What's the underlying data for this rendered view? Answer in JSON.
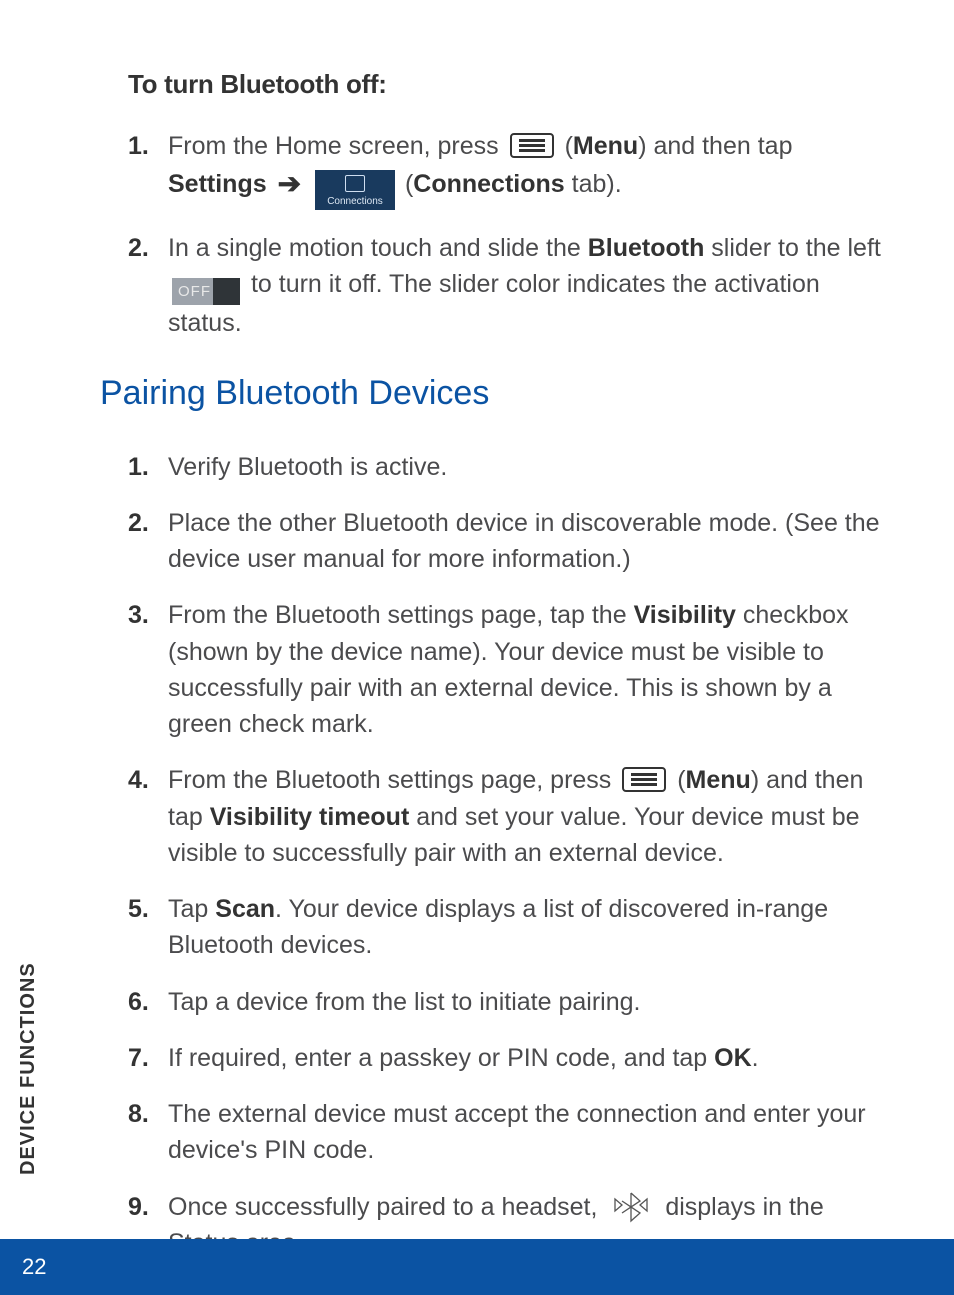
{
  "side_tab": "DEVICE FUNCTIONS",
  "page_number": "22",
  "section1": {
    "heading": "To turn Bluetooth off:",
    "steps": [
      {
        "num": "1.",
        "pre": "From the Home screen, press ",
        "menu_lbl": "Menu",
        "mid": ") and then tap ",
        "settings": "Settings",
        "conn_word": "Connections",
        "tail": " tab)."
      },
      {
        "num": "2.",
        "pre": "In a single motion touch and slide the ",
        "bt": "Bluetooth",
        "mid": " slider to the left ",
        "post": " to turn it off. The slider color indicates the activation status."
      }
    ]
  },
  "section2": {
    "heading": "Pairing Bluetooth Devices",
    "steps": [
      {
        "num": "1.",
        "text": "Verify Bluetooth is active."
      },
      {
        "num": "2.",
        "text": "Place the other Bluetooth device in discoverable mode. (See the device user manual for more information.)"
      },
      {
        "num": "3.",
        "pre": "From the Bluetooth settings page, tap the ",
        "bold": "Visibility",
        "post": " checkbox (shown by the device name). Your device must be visible to successfully pair with an external device. This is shown by a green check mark."
      },
      {
        "num": "4.",
        "pre": "From the Bluetooth settings page, press ",
        "menu_lbl": "Menu",
        "mid": ") and then tap ",
        "bold": "Visibility timeout",
        "post": " and set your value. Your device must be visible to successfully pair with an external device."
      },
      {
        "num": "5.",
        "pre": "Tap ",
        "bold": "Scan",
        "post": ". Your device displays a list of discovered in-range Bluetooth devices."
      },
      {
        "num": "6.",
        "text": "Tap a device from the list to initiate pairing."
      },
      {
        "num": "7.",
        "pre": "If required, enter a passkey or PIN code, and tap ",
        "bold": "OK",
        "post": "."
      },
      {
        "num": "8.",
        "text": "The external device must accept the connection and enter your device's PIN code."
      },
      {
        "num": "9.",
        "pre": "Once successfully paired to a headset, ",
        "post": " displays in the Status area."
      }
    ]
  },
  "icons": {
    "connections_caption": "Connections",
    "off_caption": "OFF"
  }
}
